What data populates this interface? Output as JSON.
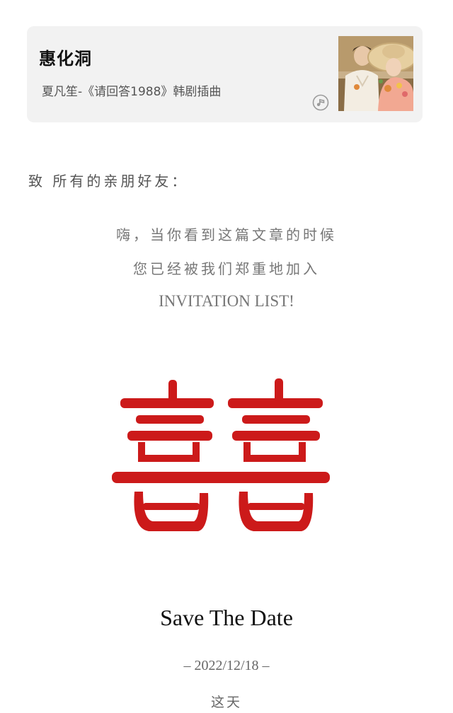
{
  "music_card": {
    "title": "惠化洞",
    "subtitle": "夏凡笙-《请回答1988》韩剧插曲",
    "play_icon": "music-note-icon",
    "cover_image": "couple-photo"
  },
  "invitation": {
    "greeting": "致 所有的亲朋好友：",
    "line1": "嗨，当你看到这篇文章的时候",
    "line2": "您已经被我们郑重地加入",
    "line3": "INVITATION LIST!",
    "double_happiness_color": "#cc1a1a",
    "double_happiness_text": "囍"
  },
  "save_the_date": {
    "title": "Save The Date",
    "date": "– 2022/12/18 –",
    "caption": "这天"
  }
}
